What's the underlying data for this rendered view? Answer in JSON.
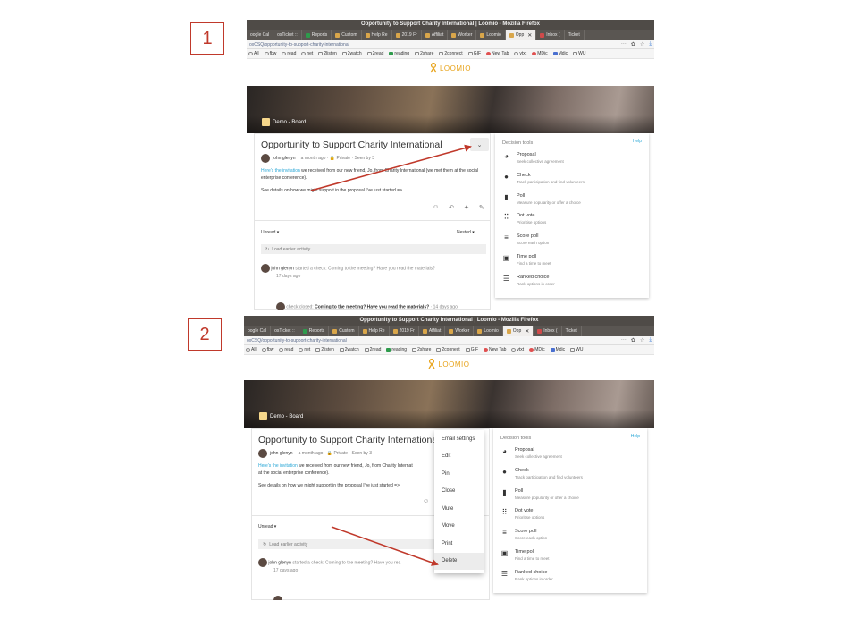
{
  "steps": [
    {
      "label": "1",
      "browser": {
        "title": "Opportunity to Support Charity International | Loomio - Mozilla Firefox",
        "tabs": [
          {
            "label": "oogle Cal",
            "active": false
          },
          {
            "label": "osTicket ::",
            "active": false
          },
          {
            "label": "Reports",
            "active": false
          },
          {
            "label": "Custom",
            "active": false
          },
          {
            "label": "Help Re",
            "active": false
          },
          {
            "label": "2019 Fr",
            "active": false
          },
          {
            "label": "Affiliat",
            "active": false
          },
          {
            "label": "Worker",
            "active": false
          },
          {
            "label": "Loomio",
            "active": false
          },
          {
            "label": "Opp",
            "active": true
          },
          {
            "label": "Inbox (",
            "active": false
          },
          {
            "label": "Ticket",
            "active": false
          }
        ],
        "url": "oxCSQ/opportunity-to-support-charity-international",
        "url_actions": [
          "···",
          "✿",
          "☆"
        ],
        "bookmarks": [
          "All",
          "fbw",
          "read",
          "net",
          "2listen",
          "2watch",
          "2read",
          "reading",
          "2share",
          "2connect",
          "GIF",
          "New Tab",
          "vtxt",
          "MDic",
          "Mdic",
          "WU"
        ]
      },
      "app": {
        "logo": "LOOMIO",
        "group": "Demo - Board",
        "thread_title": "Opportunity to Support Charity International",
        "author": "john glenyn",
        "meta": "· a month ago · 🔒 Private · Seen by 3",
        "body_link": "Here's the invitation",
        "body_1": " we received from our new friend, Jo, from Charity International (we met them at the social enterprise conference).",
        "body_2": "See details on how we might support in the proposal I've just started =>",
        "filter_left": "Unread ▾",
        "filter_right": "Nested ▾",
        "load_earlier": "Load earlier activity",
        "event_author": "john glenyn",
        "event_text": " started a check: Coming to the meeting? Have you read the materials?",
        "event_time": "17 days ago",
        "closed_prefix": "check closed: ",
        "closed_bold": "Coming to the meeting? Have you read the materials?",
        "closed_time": " · 14 days ago"
      }
    },
    {
      "label": "2",
      "browser": {
        "title": "Opportunity to Support Charity International | Loomio - Mozilla Firefox",
        "tabs": [
          {
            "label": "oogle Cal",
            "active": false
          },
          {
            "label": "osTicket ::",
            "active": false
          },
          {
            "label": "Reports",
            "active": false
          },
          {
            "label": "Custom",
            "active": false
          },
          {
            "label": "Help Re",
            "active": false
          },
          {
            "label": "2019 Fr",
            "active": false
          },
          {
            "label": "Affiliat",
            "active": false
          },
          {
            "label": "Worker",
            "active": false
          },
          {
            "label": "Loomio",
            "active": false
          },
          {
            "label": "Opp",
            "active": true
          },
          {
            "label": "Inbox (",
            "active": false
          },
          {
            "label": "Ticket",
            "active": false
          }
        ],
        "url": "oxCSQ/opportunity-to-support-charity-international",
        "url_actions": [
          "···",
          "✿",
          "☆"
        ],
        "bookmarks": [
          "All",
          "fbw",
          "read",
          "net",
          "2listen",
          "2watch",
          "2read",
          "reading",
          "2share",
          "2connect",
          "GIF",
          "New Tab",
          "vtxt",
          "MDic",
          "Mdic",
          "WU"
        ]
      },
      "app": {
        "logo": "LOOMIO",
        "group": "Demo - Board",
        "thread_title": "Opportunity to Support Charity International",
        "author": "john glenyn",
        "meta": "· a month ago · 🔒 Private · Seen by 3",
        "body_link": "Here's the invitation",
        "body_1": " we received from our new friend, Jo, from Charity Internat",
        "body_1b": "at the social enterprise conference).",
        "body_2": "See details on how we might support in the proposal I've just started =>",
        "filter_left": "Unread ▾",
        "load_earlier": "Load earlier activity",
        "event_author": "john glenyn",
        "event_text": " started a check: Coming to the meeting? Have you rea",
        "event_time": "17 days ago"
      },
      "menu": [
        "Email settings",
        "Edit",
        "Pin",
        "Close",
        "Mute",
        "Move",
        "Print",
        "Delete"
      ]
    }
  ],
  "decision_tools": {
    "header": "Decision tools",
    "help": "Help",
    "items": [
      {
        "icon": "proposal-icon",
        "glyph": "◕",
        "name": "Proposal",
        "desc": "Seek collective agreement"
      },
      {
        "icon": "check-icon",
        "glyph": "●",
        "name": "Check",
        "desc": "Track participation and find volunteers"
      },
      {
        "icon": "poll-icon",
        "glyph": "▮",
        "name": "Poll",
        "desc": "Measure popularity or offer a choice"
      },
      {
        "icon": "dot-vote-icon",
        "glyph": "⠿",
        "name": "Dot vote",
        "desc": "Prioritise options"
      },
      {
        "icon": "score-poll-icon",
        "glyph": "≡",
        "name": "Score poll",
        "desc": "Score each option"
      },
      {
        "icon": "time-poll-icon",
        "glyph": "▣",
        "name": "Time poll",
        "desc": "Find a time to meet"
      },
      {
        "icon": "ranked-choice-icon",
        "glyph": "☰",
        "name": "Ranked choice",
        "desc": "Rank options in order"
      }
    ]
  },
  "colors": {
    "accent": "#e8a41c",
    "link": "#2aa7d6",
    "annotation": "#c0392b"
  }
}
